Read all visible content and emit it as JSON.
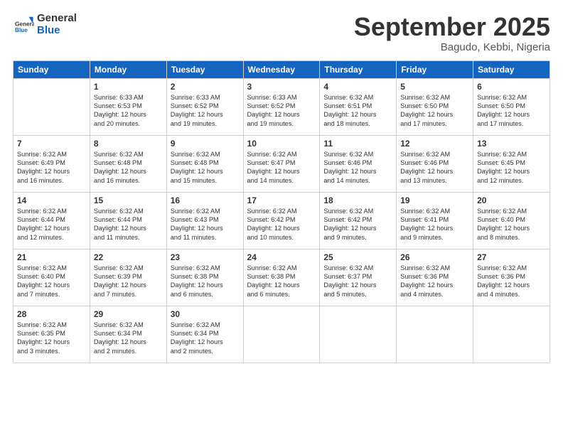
{
  "logo": {
    "general": "General",
    "blue": "Blue"
  },
  "title": "September 2025",
  "subtitle": "Bagudo, Kebbi, Nigeria",
  "days": [
    "Sunday",
    "Monday",
    "Tuesday",
    "Wednesday",
    "Thursday",
    "Friday",
    "Saturday"
  ],
  "weeks": [
    [
      {
        "date": "",
        "info": ""
      },
      {
        "date": "1",
        "info": "Sunrise: 6:33 AM\nSunset: 6:53 PM\nDaylight: 12 hours\nand 20 minutes."
      },
      {
        "date": "2",
        "info": "Sunrise: 6:33 AM\nSunset: 6:52 PM\nDaylight: 12 hours\nand 19 minutes."
      },
      {
        "date": "3",
        "info": "Sunrise: 6:33 AM\nSunset: 6:52 PM\nDaylight: 12 hours\nand 19 minutes."
      },
      {
        "date": "4",
        "info": "Sunrise: 6:32 AM\nSunset: 6:51 PM\nDaylight: 12 hours\nand 18 minutes."
      },
      {
        "date": "5",
        "info": "Sunrise: 6:32 AM\nSunset: 6:50 PM\nDaylight: 12 hours\nand 17 minutes."
      },
      {
        "date": "6",
        "info": "Sunrise: 6:32 AM\nSunset: 6:50 PM\nDaylight: 12 hours\nand 17 minutes."
      }
    ],
    [
      {
        "date": "7",
        "info": "Sunrise: 6:32 AM\nSunset: 6:49 PM\nDaylight: 12 hours\nand 16 minutes."
      },
      {
        "date": "8",
        "info": "Sunrise: 6:32 AM\nSunset: 6:48 PM\nDaylight: 12 hours\nand 16 minutes."
      },
      {
        "date": "9",
        "info": "Sunrise: 6:32 AM\nSunset: 6:48 PM\nDaylight: 12 hours\nand 15 minutes."
      },
      {
        "date": "10",
        "info": "Sunrise: 6:32 AM\nSunset: 6:47 PM\nDaylight: 12 hours\nand 14 minutes."
      },
      {
        "date": "11",
        "info": "Sunrise: 6:32 AM\nSunset: 6:46 PM\nDaylight: 12 hours\nand 14 minutes."
      },
      {
        "date": "12",
        "info": "Sunrise: 6:32 AM\nSunset: 6:46 PM\nDaylight: 12 hours\nand 13 minutes."
      },
      {
        "date": "13",
        "info": "Sunrise: 6:32 AM\nSunset: 6:45 PM\nDaylight: 12 hours\nand 12 minutes."
      }
    ],
    [
      {
        "date": "14",
        "info": "Sunrise: 6:32 AM\nSunset: 6:44 PM\nDaylight: 12 hours\nand 12 minutes."
      },
      {
        "date": "15",
        "info": "Sunrise: 6:32 AM\nSunset: 6:44 PM\nDaylight: 12 hours\nand 11 minutes."
      },
      {
        "date": "16",
        "info": "Sunrise: 6:32 AM\nSunset: 6:43 PM\nDaylight: 12 hours\nand 11 minutes."
      },
      {
        "date": "17",
        "info": "Sunrise: 6:32 AM\nSunset: 6:42 PM\nDaylight: 12 hours\nand 10 minutes."
      },
      {
        "date": "18",
        "info": "Sunrise: 6:32 AM\nSunset: 6:42 PM\nDaylight: 12 hours\nand 9 minutes."
      },
      {
        "date": "19",
        "info": "Sunrise: 6:32 AM\nSunset: 6:41 PM\nDaylight: 12 hours\nand 9 minutes."
      },
      {
        "date": "20",
        "info": "Sunrise: 6:32 AM\nSunset: 6:40 PM\nDaylight: 12 hours\nand 8 minutes."
      }
    ],
    [
      {
        "date": "21",
        "info": "Sunrise: 6:32 AM\nSunset: 6:40 PM\nDaylight: 12 hours\nand 7 minutes."
      },
      {
        "date": "22",
        "info": "Sunrise: 6:32 AM\nSunset: 6:39 PM\nDaylight: 12 hours\nand 7 minutes."
      },
      {
        "date": "23",
        "info": "Sunrise: 6:32 AM\nSunset: 6:38 PM\nDaylight: 12 hours\nand 6 minutes."
      },
      {
        "date": "24",
        "info": "Sunrise: 6:32 AM\nSunset: 6:38 PM\nDaylight: 12 hours\nand 6 minutes."
      },
      {
        "date": "25",
        "info": "Sunrise: 6:32 AM\nSunset: 6:37 PM\nDaylight: 12 hours\nand 5 minutes."
      },
      {
        "date": "26",
        "info": "Sunrise: 6:32 AM\nSunset: 6:36 PM\nDaylight: 12 hours\nand 4 minutes."
      },
      {
        "date": "27",
        "info": "Sunrise: 6:32 AM\nSunset: 6:36 PM\nDaylight: 12 hours\nand 4 minutes."
      }
    ],
    [
      {
        "date": "28",
        "info": "Sunrise: 6:32 AM\nSunset: 6:35 PM\nDaylight: 12 hours\nand 3 minutes."
      },
      {
        "date": "29",
        "info": "Sunrise: 6:32 AM\nSunset: 6:34 PM\nDaylight: 12 hours\nand 2 minutes."
      },
      {
        "date": "30",
        "info": "Sunrise: 6:32 AM\nSunset: 6:34 PM\nDaylight: 12 hours\nand 2 minutes."
      },
      {
        "date": "",
        "info": ""
      },
      {
        "date": "",
        "info": ""
      },
      {
        "date": "",
        "info": ""
      },
      {
        "date": "",
        "info": ""
      }
    ]
  ]
}
